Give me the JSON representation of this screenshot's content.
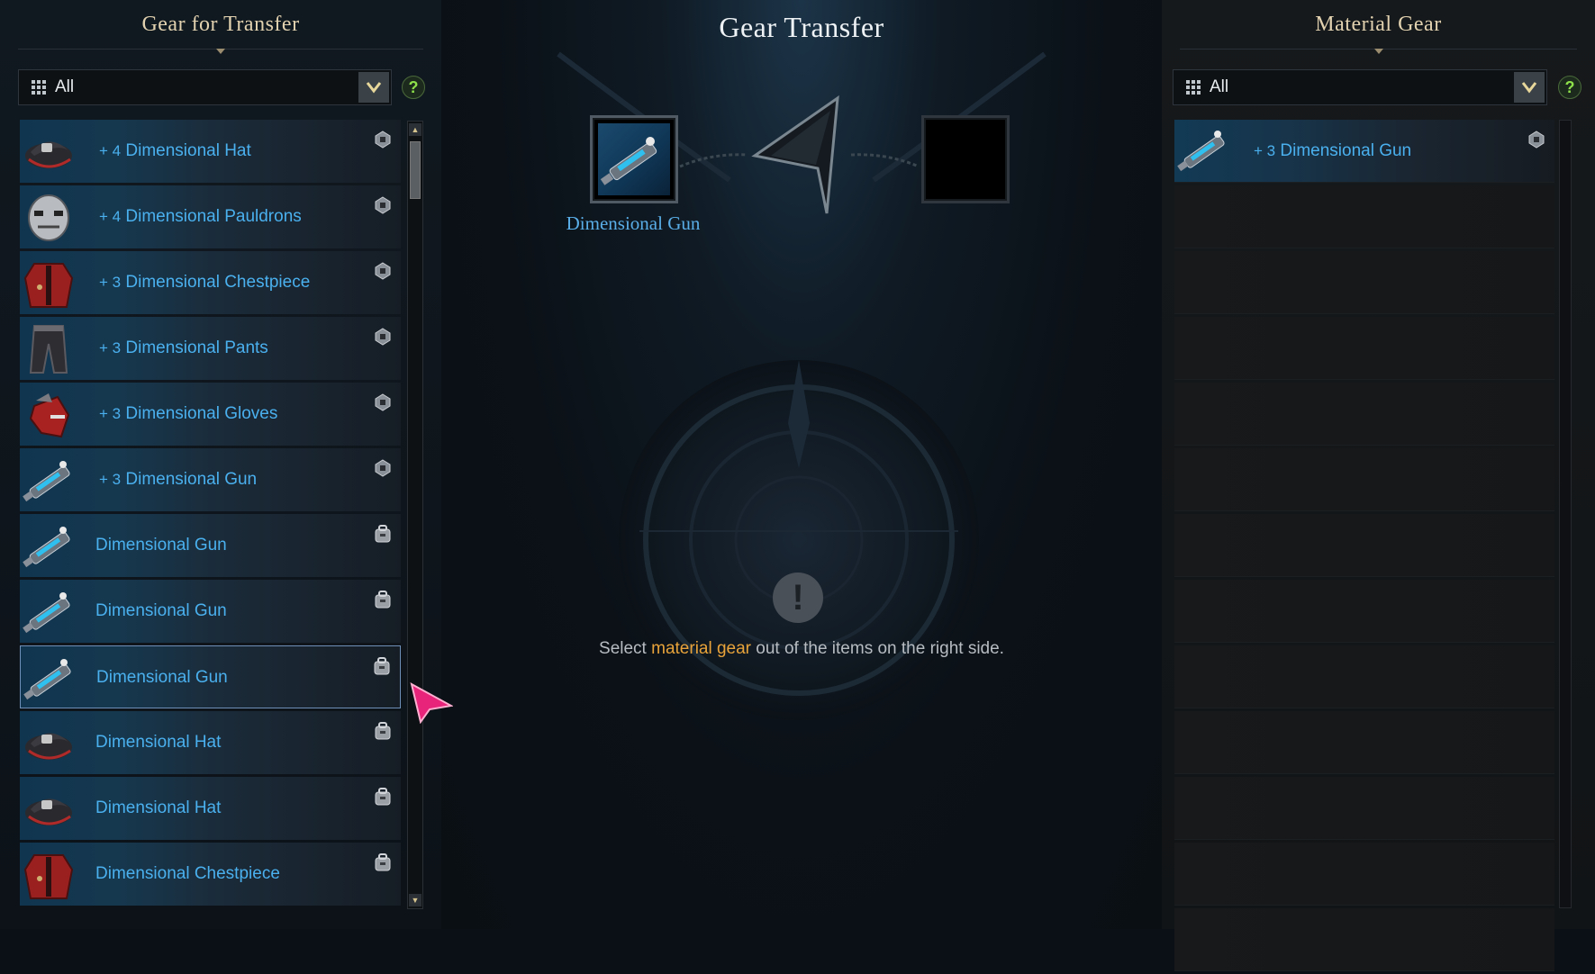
{
  "left_panel": {
    "title": "Gear for Transfer",
    "filter": {
      "label": "All"
    },
    "help": "?",
    "items": [
      {
        "prefix": "+ 4",
        "name": "Dimensional Hat",
        "icon": "hat-icon",
        "state": "equipped"
      },
      {
        "prefix": "+ 4",
        "name": "Dimensional Pauldrons",
        "icon": "mask-icon",
        "state": "equipped"
      },
      {
        "prefix": "+ 3",
        "name": "Dimensional Chestpiece",
        "icon": "chestpiece-icon",
        "state": "equipped"
      },
      {
        "prefix": "+ 3",
        "name": "Dimensional Pants",
        "icon": "pants-icon",
        "state": "equipped"
      },
      {
        "prefix": "+ 3",
        "name": "Dimensional Gloves",
        "icon": "gloves-icon",
        "state": "equipped"
      },
      {
        "prefix": "+ 3",
        "name": "Dimensional Gun",
        "icon": "gun-icon",
        "state": "equipped"
      },
      {
        "prefix": "",
        "name": "Dimensional Gun",
        "icon": "gun-icon",
        "state": "inventory"
      },
      {
        "prefix": "",
        "name": "Dimensional Gun",
        "icon": "gun-icon",
        "state": "inventory"
      },
      {
        "prefix": "",
        "name": "Dimensional Gun",
        "icon": "gun-icon",
        "state": "inventory",
        "selected": true
      },
      {
        "prefix": "",
        "name": "Dimensional Hat",
        "icon": "hat-icon",
        "state": "inventory"
      },
      {
        "prefix": "",
        "name": "Dimensional Hat",
        "icon": "hat-icon",
        "state": "inventory"
      },
      {
        "prefix": "",
        "name": "Dimensional Chestpiece",
        "icon": "chestpiece-icon",
        "state": "inventory"
      }
    ]
  },
  "center_panel": {
    "title": "Gear Transfer",
    "source_slot": {
      "icon": "gun-icon",
      "name": "Dimensional Gun"
    },
    "target_slot": {
      "icon": ""
    },
    "arrow_icon": "transfer-arrow-icon",
    "info_icon": "exclamation-icon",
    "message": {
      "before": "Select ",
      "highlight": "material gear",
      "after": " out of the items on the right side."
    }
  },
  "right_panel": {
    "title": "Material Gear",
    "filter": {
      "label": "All"
    },
    "help": "?",
    "items": [
      {
        "prefix": "+ 3",
        "name": "Dimensional Gun",
        "icon": "gun-icon",
        "state": "equipped"
      }
    ],
    "empty_rows": 12
  },
  "colors": {
    "item_name": "#4ab0ee",
    "title": "#e2d2b0",
    "highlight": "#e8a33a",
    "help": "#8ee04a",
    "cursor": "#e8237a"
  }
}
